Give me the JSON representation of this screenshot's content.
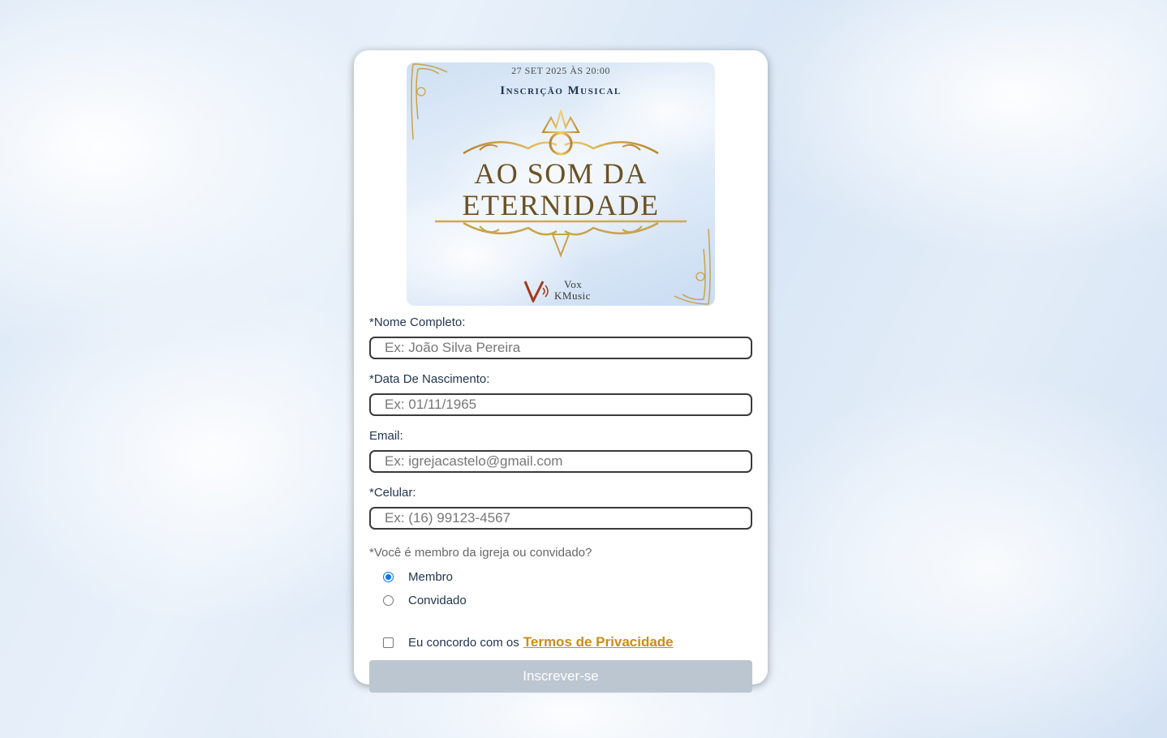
{
  "banner": {
    "date": "27 SET 2025 ÀS 20:00",
    "subtitle": "Inscrição Musical",
    "title_line1": "AO SOM DA",
    "title_line2": "ETERNIDADE",
    "logo_line1": "Vox",
    "logo_line2": "KMusic"
  },
  "form": {
    "name_label": "*Nome Completo:",
    "name_placeholder": "Ex: João Silva Pereira",
    "birth_label": "*Data De Nascimento:",
    "birth_placeholder": "Ex: 01/11/1965",
    "email_label": "Email:",
    "email_placeholder": "Ex: igrejacastelo@gmail.com",
    "phone_label": "*Celular:",
    "phone_placeholder": "Ex: (16) 99123-4567",
    "question": "*Você é membro da igreja ou convidado?",
    "options": [
      {
        "label": "Membro",
        "selected": true
      },
      {
        "label": "Convidado",
        "selected": false
      }
    ],
    "terms_text": "Eu concordo com os",
    "terms_link": "Termos de Privacidade",
    "terms_checked": false,
    "submit_label": "Inscrever-se"
  },
  "colors": {
    "accent_gold": "#c98d1a",
    "label_text": "#22354f",
    "submit_disabled": "#bcc6d0",
    "radio_selected": "#0075ff"
  }
}
